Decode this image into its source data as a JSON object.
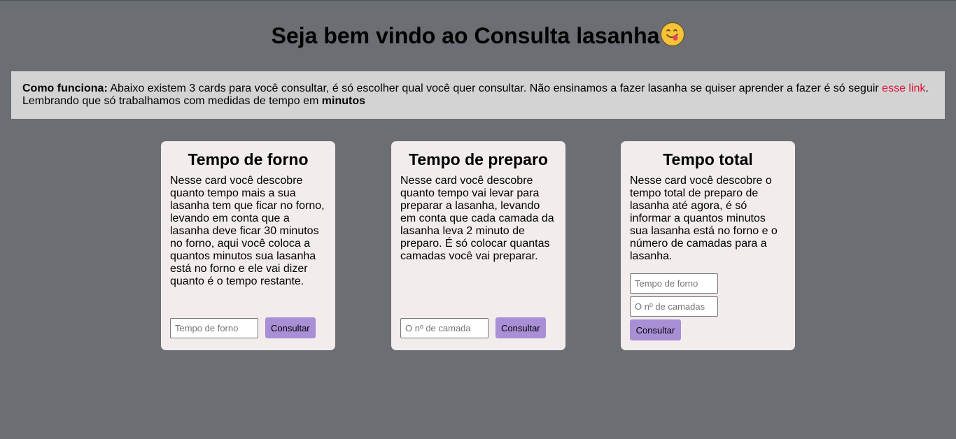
{
  "header": {
    "title": "Seja bem vindo ao Consulta lasanha",
    "emoji_icon": "face-savoring-food-icon"
  },
  "info": {
    "label": "Como funciona:",
    "text_before_link": " Abaixo existem 3 cards para você consultar, é só escolher qual você quer consultar. Não ensinamos a fazer lasanha se quiser aprender a fazer é só seguir ",
    "link_text": "esse link",
    "text_after_link": ".",
    "line2_text": "Lembrando que só trabalhamos com medidas de tempo em ",
    "line2_bold": "minutos"
  },
  "cards": [
    {
      "title": "Tempo de forno",
      "description": "Nesse card você descobre quanto tempo mais a sua lasanha tem que ficar no forno, levando em conta que a lasanha deve ficar 30 minutos no forno, aqui você coloca a quantos minutos sua lasanha está no forno e ele vai dizer quanto é o tempo restante.",
      "input_placeholder": "Tempo de forno",
      "button_label": "Consultar"
    },
    {
      "title": "Tempo de preparo",
      "description": "Nesse card você descobre quanto tempo vai levar para preparar a lasanha, levando em conta que cada camada da lasanha leva 2 minuto de preparo. É só colocar quantas camadas você vai preparar.",
      "input_placeholder": "O nº de camada",
      "button_label": "Consultar"
    },
    {
      "title": "Tempo total",
      "description": "Nesse card você descobre o tempo total de preparo de lasanha até agora, é só informar a quantos minutos sua lasanha está no forno e o número de camadas para a lasanha.",
      "input1_placeholder": "Tempo de forno",
      "input2_placeholder": "O nº de camadas",
      "button_label": "Consultar"
    }
  ],
  "colors": {
    "background": "#6b6e73",
    "info_box": "#d3d3d3",
    "card": "#f2ecec",
    "button": "#a98fd5",
    "link": "#dc143c"
  }
}
